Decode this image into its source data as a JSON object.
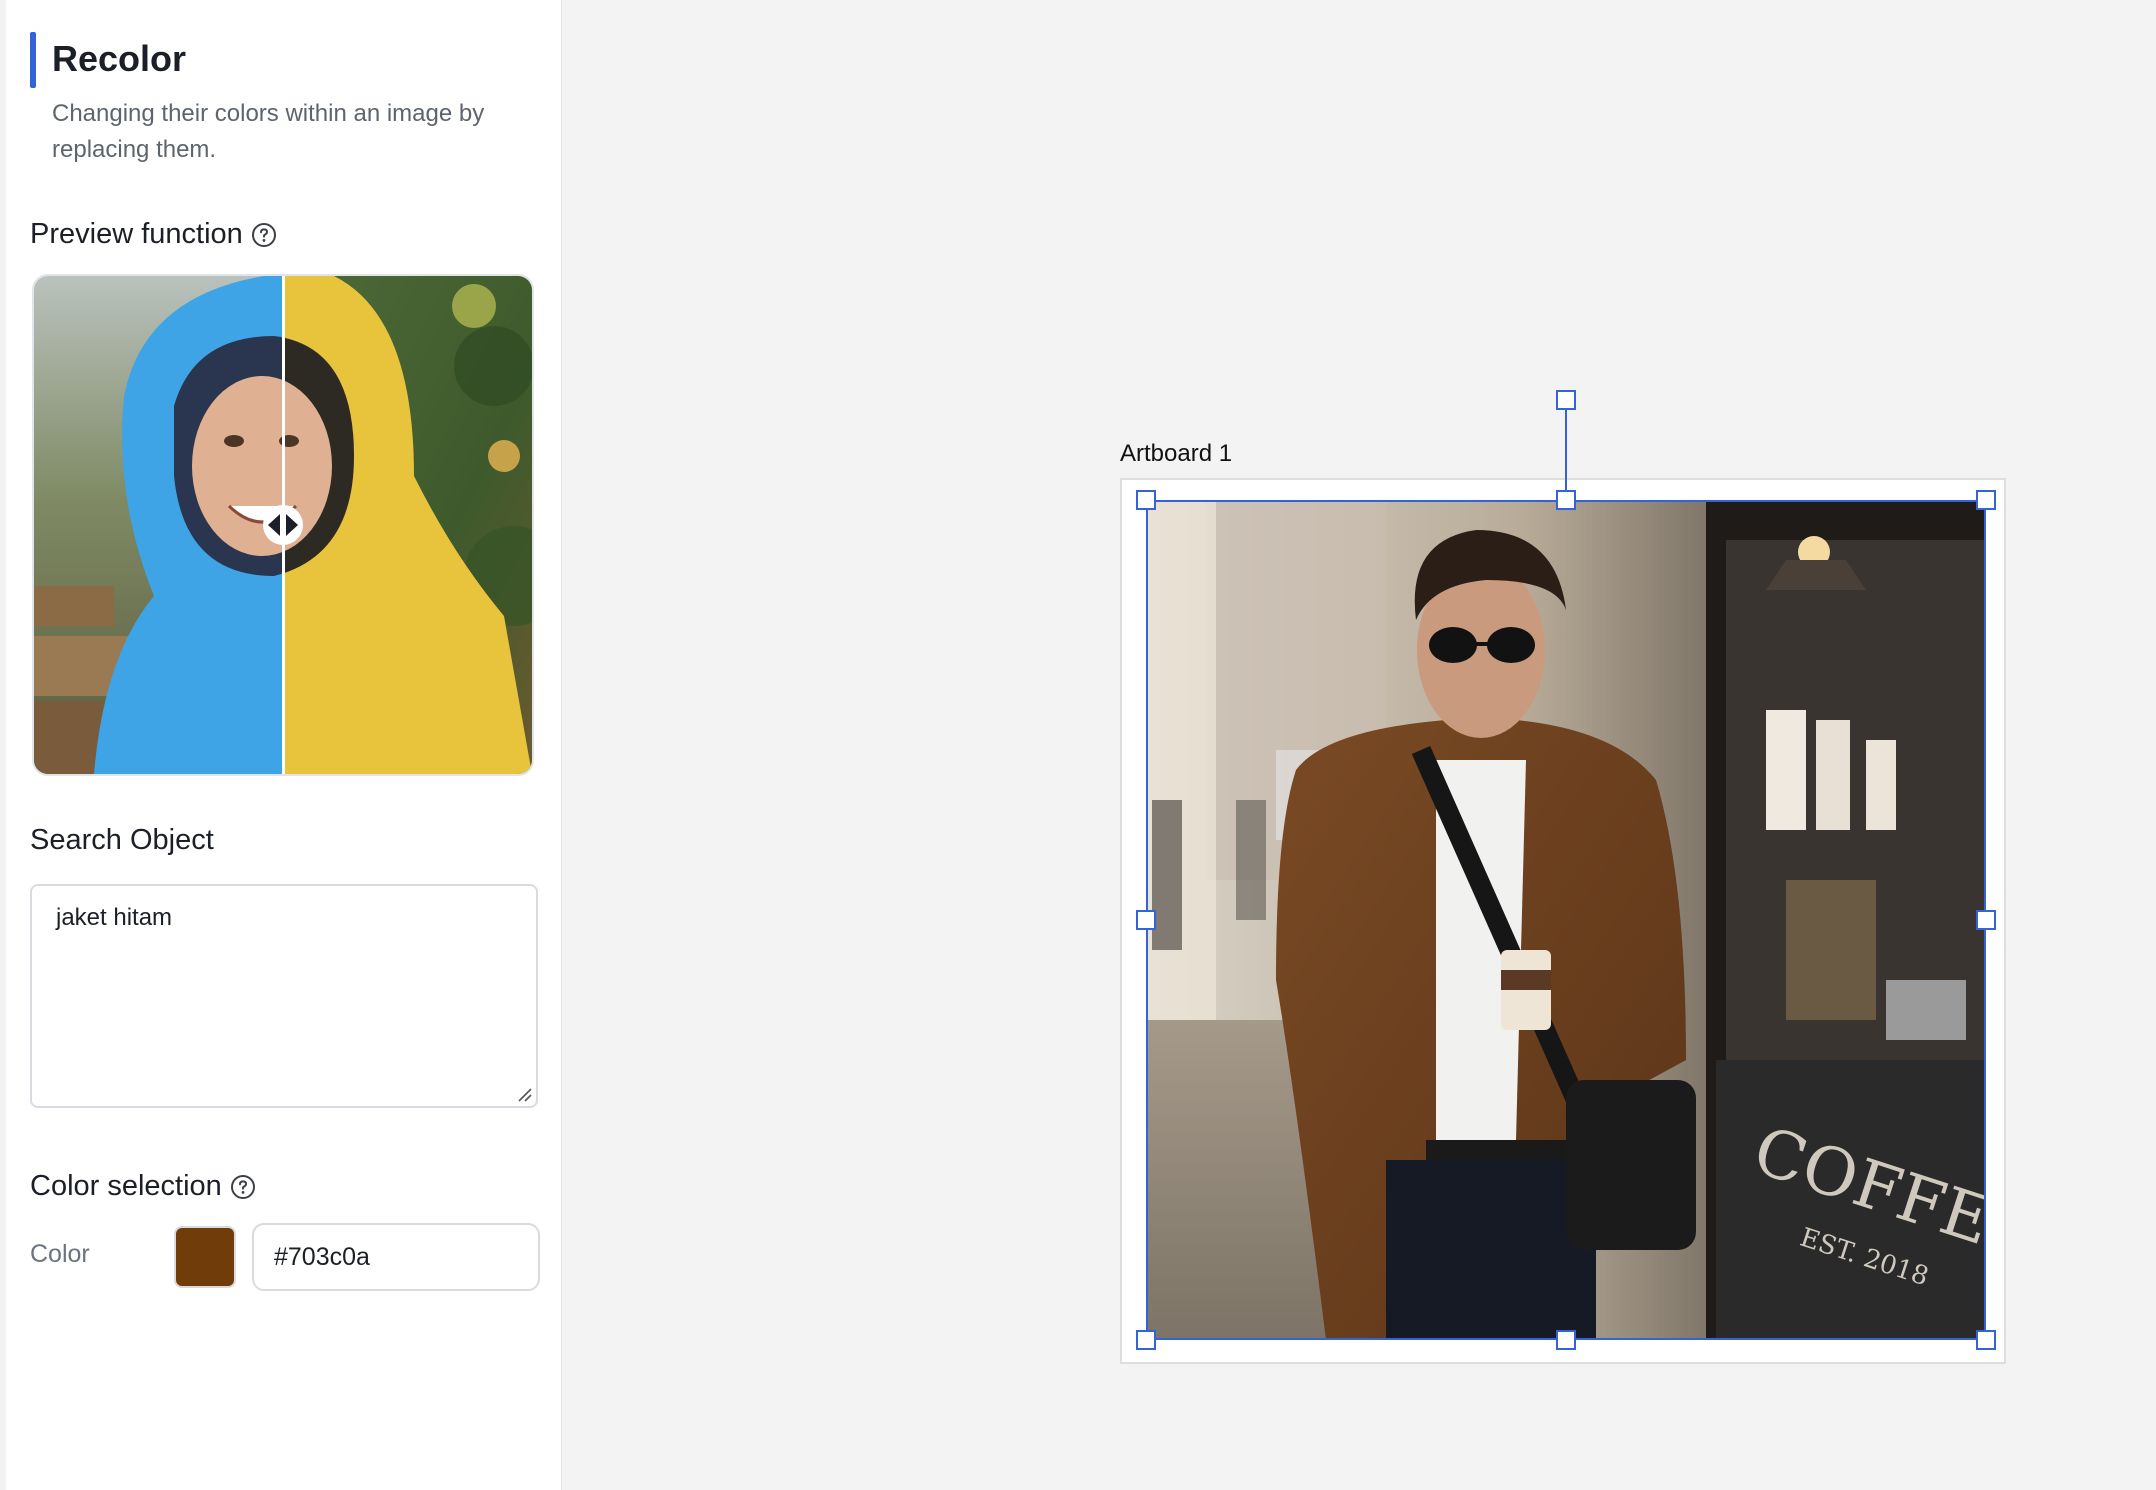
{
  "panel": {
    "title": "Recolor",
    "subtitle": "Changing their colors within an image by replacing them.",
    "preview_label": "Preview function",
    "search_label": "Search Object",
    "search_value": "jaket hitam",
    "color_section_label": "Color selection",
    "color_label": "Color",
    "color_value": "#703c0a"
  },
  "canvas": {
    "artboard_label": "Artboard 1",
    "photo_sign_text": "COFFEE",
    "photo_sign_subtext": "EST. 2018"
  },
  "colors": {
    "accent": "#3463d8",
    "selected_color": "#703c0a",
    "canvas_bg": "#f3f3f3"
  },
  "icons": [
    "help-circle-icon",
    "compare-slider-icon",
    "resize-grip-icon"
  ]
}
